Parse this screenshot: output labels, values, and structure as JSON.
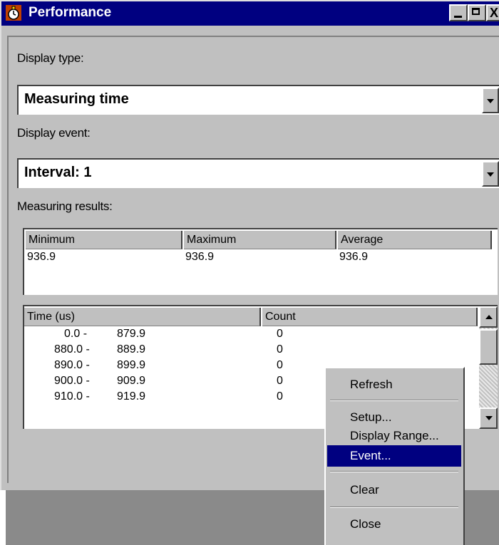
{
  "window": {
    "title": "Performance",
    "minimize_glyph": "_",
    "maximize_glyph": "□",
    "close_glyph": "X"
  },
  "display_type": {
    "label": "Display type:",
    "value": "Measuring time"
  },
  "display_event": {
    "label": "Display event:",
    "value": "Interval: 1"
  },
  "measuring_results": {
    "label": "Measuring results:",
    "headers": [
      "Minimum",
      "Maximum",
      "Average"
    ],
    "values": [
      "936.9",
      "936.9",
      "936.9"
    ]
  },
  "histogram": {
    "headers": [
      "Time (us)",
      "Count"
    ],
    "rows": [
      {
        "from": "0.0 -",
        "to": "879.9",
        "count": "0"
      },
      {
        "from": "880.0 -",
        "to": "889.9",
        "count": "0"
      },
      {
        "from": "890.0 -",
        "to": "899.9",
        "count": "0"
      },
      {
        "from": "900.0 -",
        "to": "909.9",
        "count": "0"
      },
      {
        "from": "910.0 -",
        "to": "919.9",
        "count": "0"
      }
    ]
  },
  "context_menu": {
    "items": [
      "Refresh",
      "Setup...",
      "Display Range...",
      "Event...",
      "Clear",
      "Close"
    ],
    "selected": "Event..."
  },
  "colors": {
    "titlebar": "#000080",
    "face": "#c0c0c0",
    "selection": "#000080"
  }
}
